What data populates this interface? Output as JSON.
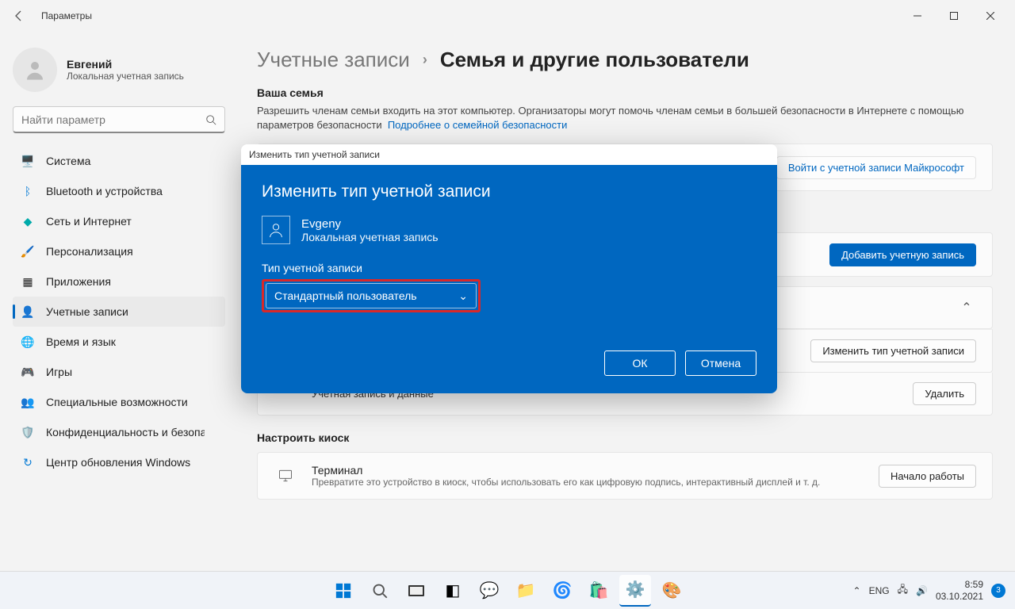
{
  "window": {
    "title": "Параметры"
  },
  "user": {
    "name": "Евгений",
    "sub": "Локальная учетная запись"
  },
  "search": {
    "placeholder": "Найти параметр"
  },
  "nav": {
    "items": [
      "Система",
      "Bluetooth и устройства",
      "Сеть и Интернет",
      "Персонализация",
      "Приложения",
      "Учетные записи",
      "Время и язык",
      "Игры",
      "Специальные возможности",
      "Конфиденциальность и безопасность",
      "Центр обновления Windows"
    ]
  },
  "breadcrumb": {
    "parent": "Учетные записи",
    "current": "Семья и другие пользователи"
  },
  "family": {
    "heading": "Ваша семья",
    "desc": "Разрешить членам семьи входить на этот компьютер. Организаторы могут помочь членам семьи в большей безопасности в Интернете с помощью параметров безопасности",
    "link": "Подробнее о семейной безопасности",
    "signin_btn": "Войти с учетной записи Майкрософт"
  },
  "others": {
    "add_btn": "Добавить учетную запись",
    "change_type_btn": "Изменить тип учетной записи",
    "account_data_label": "Учетная запись и данные",
    "delete_btn": "Удалить"
  },
  "kiosk": {
    "heading": "Настроить киоск",
    "terminal": "Терминал",
    "terminal_desc": "Превратите это устройство в киоск, чтобы использовать его как цифровую подпись, интерактивный дисплей и т. д.",
    "start_btn": "Начало работы"
  },
  "dialog": {
    "titlebar": "Изменить тип учетной записи",
    "heading": "Изменить тип учетной записи",
    "user_name": "Evgeny",
    "user_sub": "Локальная учетная запись",
    "field_label": "Тип учетной записи",
    "selected": "Стандартный пользователь",
    "ok": "ОК",
    "cancel": "Отмена"
  },
  "taskbar": {
    "lang": "ENG",
    "time": "8:59",
    "date": "03.10.2021",
    "badge": "3"
  }
}
